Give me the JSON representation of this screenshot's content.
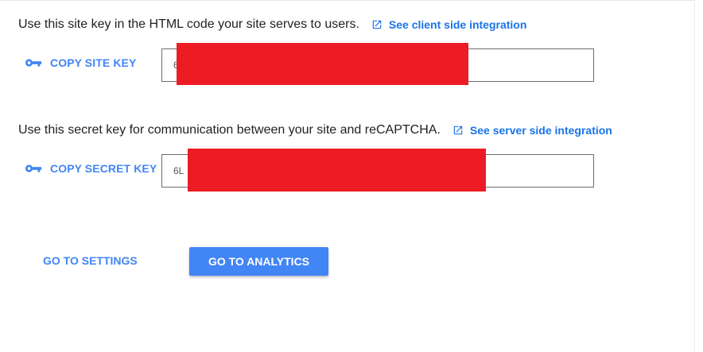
{
  "site_key": {
    "description": "Use this site key in the HTML code your site serves to users.",
    "link_label": "See client side integration",
    "copy_label": "COPY SITE KEY",
    "value": "6"
  },
  "secret_key": {
    "description": "Use this secret key for communication between your site and reCAPTCHA.",
    "link_label": "See server side integration",
    "copy_label": "COPY SECRET KEY",
    "value": "6L"
  },
  "actions": {
    "settings_label": "GO TO SETTINGS",
    "analytics_label": "GO TO ANALYTICS"
  },
  "colors": {
    "accent": "#4285f4",
    "link": "#1a73e8",
    "redaction": "#ed1c24"
  },
  "icons": {
    "key": "key-icon",
    "external_link": "open-in-new-icon"
  }
}
